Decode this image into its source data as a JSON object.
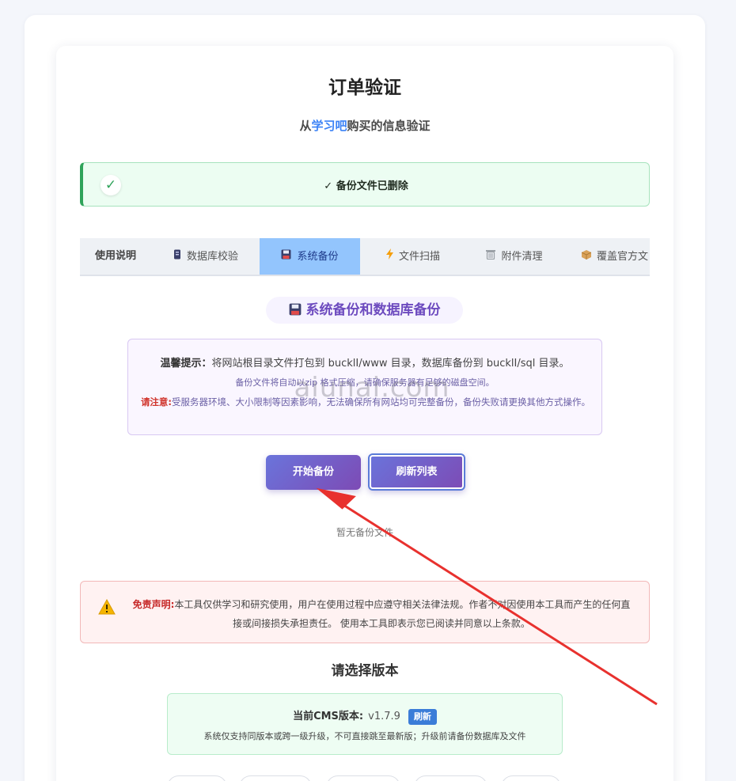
{
  "page": {
    "title": "订单验证",
    "subtitle_prefix": "从",
    "subtitle_brand": "学习吧",
    "subtitle_suffix": "购买的信息验证"
  },
  "alert": {
    "icon": "check-icon",
    "message": "✓ 备份文件已删除",
    "color": "#2fa35a"
  },
  "tabs": [
    {
      "label": "使用说明",
      "icon": ""
    },
    {
      "label": "数据库校验",
      "icon": "database-icon"
    },
    {
      "label": "系统备份",
      "icon": "floppy-disk-icon",
      "active": true
    },
    {
      "label": "文件扫描",
      "icon": "lightning-icon"
    },
    {
      "label": "附件清理",
      "icon": "trash-icon"
    },
    {
      "label": "覆盖官方文",
      "icon": "package-icon"
    }
  ],
  "section": {
    "icon": "floppy-disk-icon",
    "title": "系统备份和数据库备份"
  },
  "notice": {
    "tip_label": "温馨提示：",
    "tip_text": "将网站根目录文件打包到 bucklI/www 目录，数据库备份到 bucklI/sql 目录。",
    "line2": "备份文件将自动以zip 格式压缩，请确保服务器有足够的磁盘空间。",
    "warn_label": "请注意:",
    "warn_text": "受服务器环境、大小限制等因素影响，无法确保所有网站均可完整备份，备份失败请更换其他方式操作。"
  },
  "buttons": {
    "start": "开始备份",
    "refresh": "刷新列表"
  },
  "empty_text": "暂无备份文件",
  "watermark": "aiunai.com",
  "disclaimer": {
    "icon": "warning-icon",
    "label": "免责声明:",
    "text": "本工具仅供学习和研究使用，用户在使用过程中应遵守相关法律法规。作者不对因使用本工具而产生的任何直接或间接损失承担责任。 使用本工具即表示您已阅读并同意以上条款。"
  },
  "version": {
    "section_title": "请选择版本",
    "current_label": "当前CMS版本:",
    "current_value": "v1.7.9",
    "refresh_badge": "刷新",
    "note": "系统仅支持同版本或跨一级升级，不可直接跳至最新版；升级前请备份数据库及文件"
  },
  "colors": {
    "accent_gradient_start": "#6a74db",
    "accent_gradient_end": "#7d4bb5",
    "active_tab": "#93c5fd",
    "arrow": "#e8312e"
  }
}
